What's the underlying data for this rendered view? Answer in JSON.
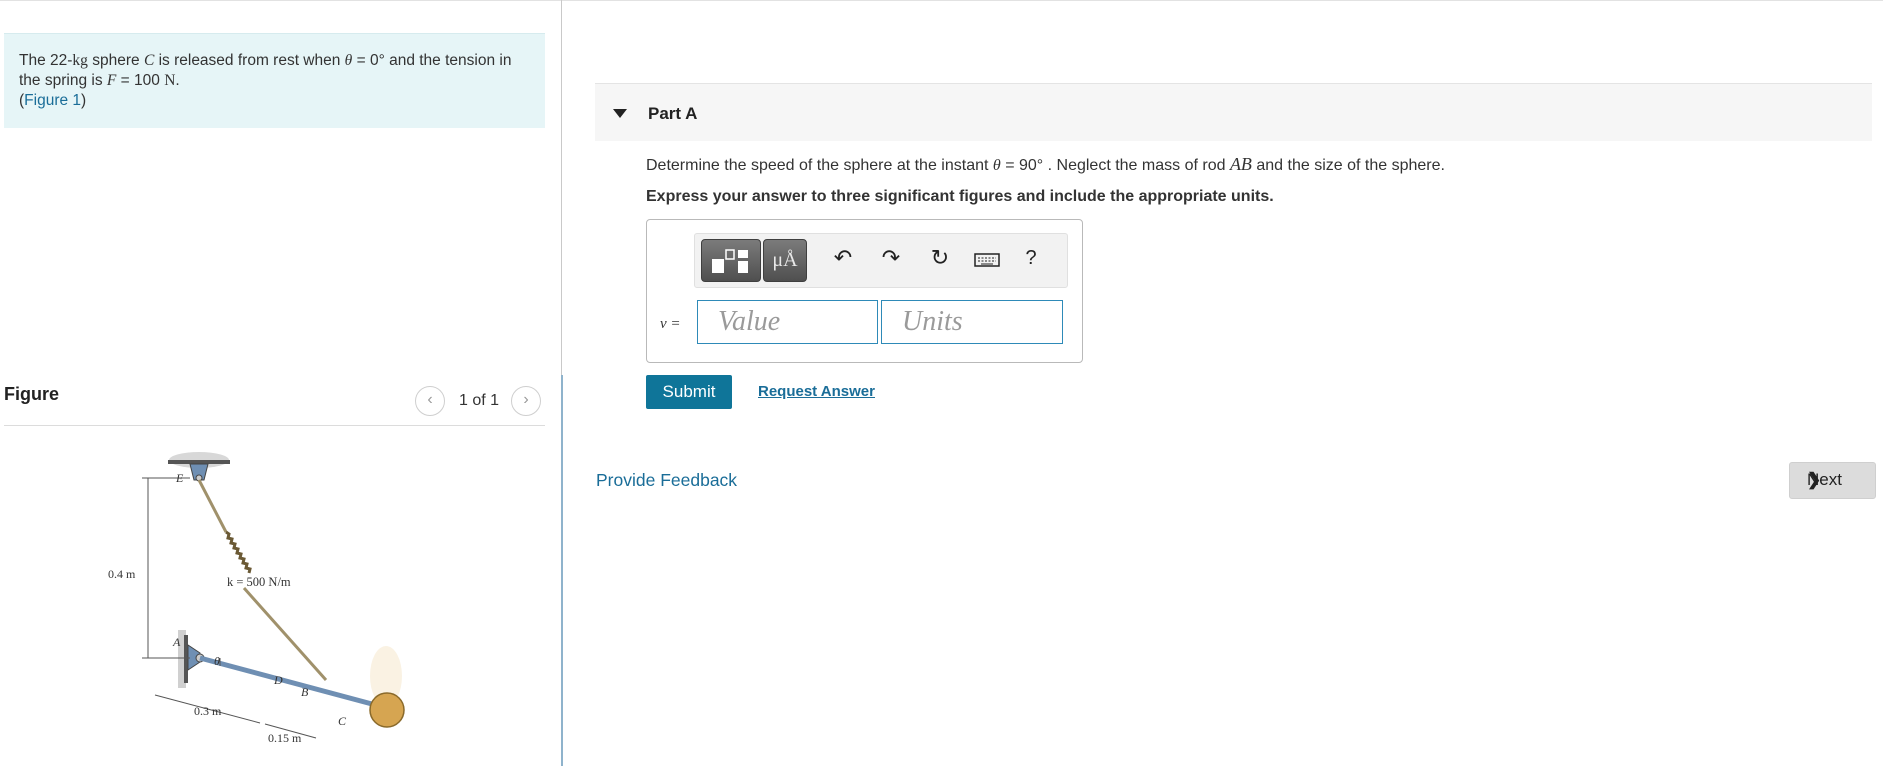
{
  "problem": {
    "text_1": "The 22-",
    "mass_unit": "kg",
    "text_2": " sphere ",
    "sphere": "C",
    "text_3": " is released from rest when ",
    "theta": "θ",
    "text_4": " = 0° and the tension in the spring is ",
    "force": "F",
    "text_5": " = 100 ",
    "force_unit": "N",
    "text_6": ".",
    "figure_link_open": "(",
    "figure_link": "Figure 1",
    "figure_link_close": ")"
  },
  "figure": {
    "header": "Figure",
    "pager": "1 of 1",
    "prev_icon": "‹",
    "next_icon": "›",
    "labels": {
      "E": "E",
      "A": "A",
      "D": "D",
      "B": "B",
      "C": "C",
      "theta": "θ",
      "height": "0.4 m",
      "spring": "k = 500 N/m",
      "d1": "0.3 m",
      "d2": "0.15 m"
    }
  },
  "part": {
    "title": "Part A",
    "question_1": "Determine the speed of the sphere at the instant ",
    "theta": "θ",
    "question_2": " = 90° . Neglect the mass of rod ",
    "rod": "AB",
    "question_3": " and the size of the sphere.",
    "instruction": "Express your answer to three significant figures and include the appropriate units."
  },
  "toolbar": {
    "units_label": "μÅ",
    "undo": "↶",
    "redo": "↷",
    "reset": "↻",
    "keyboard": "⌨",
    "help": "?"
  },
  "answer": {
    "var_label": "v =",
    "value_placeholder": "Value",
    "units_placeholder": "Units"
  },
  "actions": {
    "submit": "Submit",
    "request_answer": "Request Answer",
    "provide_feedback": "Provide Feedback",
    "next": "Next",
    "next_icon": "❯"
  }
}
